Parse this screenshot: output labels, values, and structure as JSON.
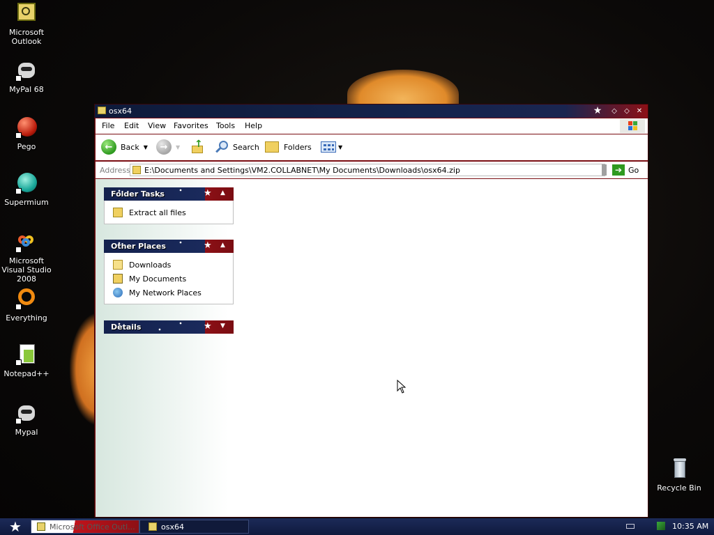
{
  "desktop": {
    "icons": [
      {
        "label": "Microsoft Outlook"
      },
      {
        "label": "MyPal 68"
      },
      {
        "label": "Pego"
      },
      {
        "label": "Supermium"
      },
      {
        "label": "Microsoft Visual Studio 2008"
      },
      {
        "label": "Everything"
      },
      {
        "label": "Notepad++"
      },
      {
        "label": "Mypal"
      }
    ],
    "recycle_bin": "Recycle Bin"
  },
  "window": {
    "title": "osx64",
    "menu": [
      "File",
      "Edit",
      "View",
      "Favorites",
      "Tools",
      "Help"
    ],
    "toolbar": {
      "back": "Back",
      "search": "Search",
      "folders": "Folders"
    },
    "address": {
      "label": "Address",
      "value": "E:\\Documents and Settings\\VM2.COLLABNET\\My Documents\\Downloads\\osx64.zip",
      "go": "Go"
    },
    "panels": [
      {
        "title": "Folder Tasks",
        "items": [
          "Extract all files"
        ]
      },
      {
        "title": "Other Places",
        "items": [
          "Downloads",
          "My Documents",
          "My Network Places"
        ]
      },
      {
        "title": "Details",
        "items": []
      }
    ]
  },
  "taskbar": {
    "items": [
      "Microsoft Office Outl...",
      "osx64"
    ],
    "clock": "10:35 AM"
  },
  "colors": {
    "title_navy": "#15244d",
    "accent_red": "#8c1016",
    "go_green": "#2f9a20"
  }
}
